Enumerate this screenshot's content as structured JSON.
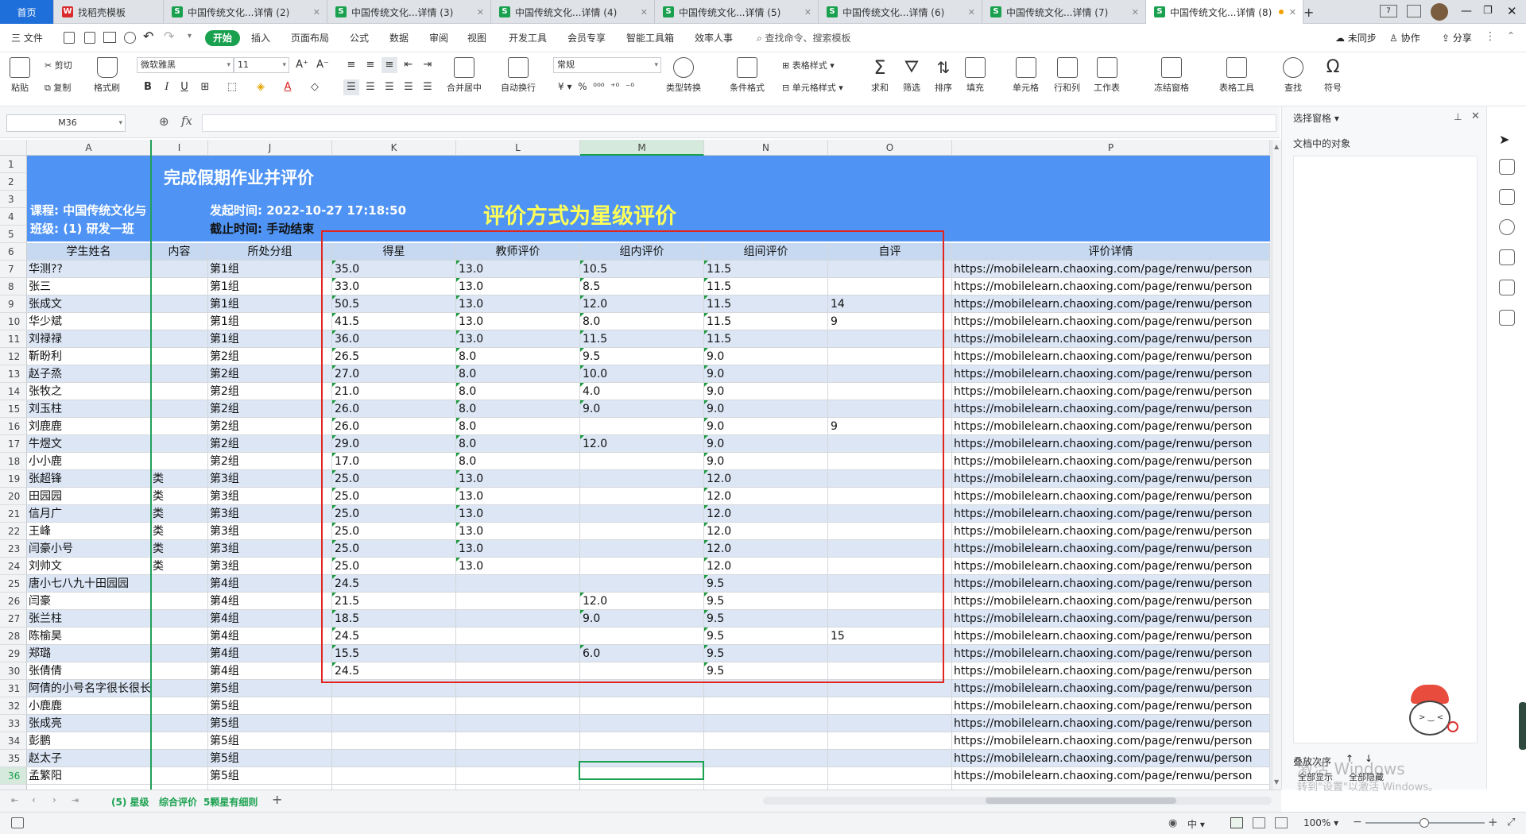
{
  "tabs": [
    {
      "label": "首页",
      "kind": "home"
    },
    {
      "label": "找稻壳模板",
      "kind": "docer"
    },
    {
      "label": "中国传统文化...详情 (2)",
      "kind": "sheet"
    },
    {
      "label": "中国传统文化...详情 (3)",
      "kind": "sheet"
    },
    {
      "label": "中国传统文化...详情 (4)",
      "kind": "sheet"
    },
    {
      "label": "中国传统文化...详情 (5)",
      "kind": "sheet"
    },
    {
      "label": "中国传统文化...详情 (6)",
      "kind": "sheet"
    },
    {
      "label": "中国传统文化...详情 (7)",
      "kind": "sheet"
    },
    {
      "label": "中国传统文化...详情 (8)",
      "kind": "sheet",
      "active": true
    }
  ],
  "menubar": {
    "file": "三 文件",
    "items": [
      "开始",
      "插入",
      "页面布局",
      "公式",
      "数据",
      "审阅",
      "视图",
      "开发工具",
      "会员专享",
      "智能工具箱",
      "效率人事"
    ],
    "search": "查找命令、搜索模板",
    "sync": "未同步",
    "collab": "协作",
    "share": "分享"
  },
  "ribbon": {
    "paste": "粘贴",
    "cut": "剪切",
    "copy": "复制",
    "format_painter": "格式刷",
    "font_name": "微软雅黑",
    "font_size": "11",
    "merge": "合并居中",
    "wrap": "自动换行",
    "number_format": "常规",
    "convert": "类型转换",
    "cond_format": "条件格式",
    "table_style": "表格样式",
    "cell_style": "单元格样式",
    "sum": "求和",
    "filter": "筛选",
    "sort": "排序",
    "fill": "填充",
    "cell": "单元格",
    "rowcol": "行和列",
    "sheet": "工作表",
    "freeze": "冻结窗格",
    "table_tools": "表格工具",
    "find": "查找",
    "symbol": "符号"
  },
  "formula_bar": {
    "name_box": "M36",
    "fx": "fx",
    "value": ""
  },
  "sheet": {
    "col_headers": [
      "A",
      "I",
      "J",
      "K",
      "L",
      "M",
      "N",
      "O",
      "P"
    ],
    "title": "完成假期作业并评价",
    "course": "课程: 中国传统文化与",
    "class": "班级: (1) 研发一班",
    "start_time": "发起时间: 2022-10-27 17:18:50",
    "end_time": "截止时间: 手动结束",
    "annotation": "评价方式为星级评价",
    "headers": {
      "A": "学生姓名",
      "I": "内容",
      "J": "所处分组",
      "K": "得星",
      "L": "教师评价",
      "M": "组内评价",
      "N": "组间评价",
      "O": "自评",
      "P": "评价详情"
    },
    "url": "https://mobilelearn.chaoxing.com/page/renwu/person",
    "rows": [
      {
        "n": "7",
        "name": "华测??",
        "i": "",
        "g": "第1组",
        "k": "35.0",
        "l": "13.0",
        "m": "10.5",
        "nn": "11.5",
        "o": ""
      },
      {
        "n": "8",
        "name": "张三",
        "i": "",
        "g": "第1组",
        "k": "33.0",
        "l": "13.0",
        "m": "8.5",
        "nn": "11.5",
        "o": ""
      },
      {
        "n": "9",
        "name": "张成文",
        "i": "",
        "g": "第1组",
        "k": "50.5",
        "l": "13.0",
        "m": "12.0",
        "nn": "11.5",
        "o": "14"
      },
      {
        "n": "10",
        "name": "华少斌",
        "i": "",
        "g": "第1组",
        "k": "41.5",
        "l": "13.0",
        "m": "8.0",
        "nn": "11.5",
        "o": "9"
      },
      {
        "n": "11",
        "name": "刘禄禄",
        "i": "",
        "g": "第1组",
        "k": "36.0",
        "l": "13.0",
        "m": "11.5",
        "nn": "11.5",
        "o": ""
      },
      {
        "n": "12",
        "name": "靳盼利",
        "i": "",
        "g": "第2组",
        "k": "26.5",
        "l": "8.0",
        "m": "9.5",
        "nn": "9.0",
        "o": ""
      },
      {
        "n": "13",
        "name": "赵子烝",
        "i": "",
        "g": "第2组",
        "k": "27.0",
        "l": "8.0",
        "m": "10.0",
        "nn": "9.0",
        "o": ""
      },
      {
        "n": "14",
        "name": "张牧之",
        "i": "",
        "g": "第2组",
        "k": "21.0",
        "l": "8.0",
        "m": "4.0",
        "nn": "9.0",
        "o": ""
      },
      {
        "n": "15",
        "name": "刘玉柱",
        "i": "",
        "g": "第2组",
        "k": "26.0",
        "l": "8.0",
        "m": "9.0",
        "nn": "9.0",
        "o": ""
      },
      {
        "n": "16",
        "name": "刘鹿鹿",
        "i": "",
        "g": "第2组",
        "k": "26.0",
        "l": "8.0",
        "m": "",
        "nn": "9.0",
        "o": "9"
      },
      {
        "n": "17",
        "name": "牛煜文",
        "i": "",
        "g": "第2组",
        "k": "29.0",
        "l": "8.0",
        "m": "12.0",
        "nn": "9.0",
        "o": ""
      },
      {
        "n": "18",
        "name": "小小鹿",
        "i": "",
        "g": "第2组",
        "k": "17.0",
        "l": "8.0",
        "m": "",
        "nn": "9.0",
        "o": ""
      },
      {
        "n": "19",
        "name": "张超锋",
        "i": "类",
        "g": "第3组",
        "k": "25.0",
        "l": "13.0",
        "m": "",
        "nn": "12.0",
        "o": ""
      },
      {
        "n": "20",
        "name": "田园园",
        "i": "类",
        "g": "第3组",
        "k": "25.0",
        "l": "13.0",
        "m": "",
        "nn": "12.0",
        "o": ""
      },
      {
        "n": "21",
        "name": "信月广",
        "i": "类",
        "g": "第3组",
        "k": "25.0",
        "l": "13.0",
        "m": "",
        "nn": "12.0",
        "o": ""
      },
      {
        "n": "22",
        "name": "王峰",
        "i": "类",
        "g": "第3组",
        "k": "25.0",
        "l": "13.0",
        "m": "",
        "nn": "12.0",
        "o": ""
      },
      {
        "n": "23",
        "name": "闫豪小号",
        "i": "类",
        "g": "第3组",
        "k": "25.0",
        "l": "13.0",
        "m": "",
        "nn": "12.0",
        "o": ""
      },
      {
        "n": "24",
        "name": "刘帅文",
        "i": "类",
        "g": "第3组",
        "k": "25.0",
        "l": "13.0",
        "m": "",
        "nn": "12.0",
        "o": ""
      },
      {
        "n": "25",
        "name": "唐小七八九十田园园",
        "i": "",
        "g": "第4组",
        "k": "24.5",
        "l": "",
        "m": "",
        "nn": "9.5",
        "o": ""
      },
      {
        "n": "26",
        "name": "闫豪",
        "i": "",
        "g": "第4组",
        "k": "21.5",
        "l": "",
        "m": "12.0",
        "nn": "9.5",
        "o": ""
      },
      {
        "n": "27",
        "name": "张兰柱",
        "i": "",
        "g": "第4组",
        "k": "18.5",
        "l": "",
        "m": "9.0",
        "nn": "9.5",
        "o": ""
      },
      {
        "n": "28",
        "name": "陈榆昊",
        "i": "",
        "g": "第4组",
        "k": "24.5",
        "l": "",
        "m": "",
        "nn": "9.5",
        "o": "15"
      },
      {
        "n": "29",
        "name": "郑璐",
        "i": "",
        "g": "第4组",
        "k": "15.5",
        "l": "",
        "m": "6.0",
        "nn": "9.5",
        "o": ""
      },
      {
        "n": "30",
        "name": "张倩倩",
        "i": "",
        "g": "第4组",
        "k": "24.5",
        "l": "",
        "m": "",
        "nn": "9.5",
        "o": ""
      },
      {
        "n": "31",
        "name": "阿倩的小号名字很长很长",
        "i": "",
        "g": "第5组",
        "k": "",
        "l": "",
        "m": "",
        "nn": "",
        "o": ""
      },
      {
        "n": "32",
        "name": "小鹿鹿",
        "i": "",
        "g": "第5组",
        "k": "",
        "l": "",
        "m": "",
        "nn": "",
        "o": ""
      },
      {
        "n": "33",
        "name": "张成亮",
        "i": "",
        "g": "第5组",
        "k": "",
        "l": "",
        "m": "",
        "nn": "",
        "o": ""
      },
      {
        "n": "34",
        "name": "彭鹏",
        "i": "",
        "g": "第5组",
        "k": "",
        "l": "",
        "m": "",
        "nn": "",
        "o": ""
      },
      {
        "n": "35",
        "name": "赵太子",
        "i": "",
        "g": "第5组",
        "k": "",
        "l": "",
        "m": "",
        "nn": "",
        "o": ""
      },
      {
        "n": "36",
        "name": "孟繁阳",
        "i": "",
        "g": "第5组",
        "k": "",
        "l": "",
        "m": "",
        "nn": "",
        "o": ""
      }
    ]
  },
  "pane": {
    "title": "选择窗格",
    "objects_label": "文档中的对象",
    "order_label": "叠放次序",
    "show_all": "全部显示",
    "hide_all": "全部隐藏"
  },
  "sheet_tabs": [
    "(5) 星级",
    "综合评价",
    "5颗星有细则"
  ],
  "status": {
    "zoom": "100%",
    "lang": "中"
  },
  "watermark": {
    "line1": "激活 Windows",
    "line2": "转到\"设置\"以激活 Windows。"
  },
  "colors": {
    "title_band": "#4f94f4",
    "header_row": "#c6d9f1",
    "alt_row": "#dce6f5",
    "accent": "#1aa14f",
    "annotation": "#ffff5a",
    "redbox": "#e0261f"
  }
}
